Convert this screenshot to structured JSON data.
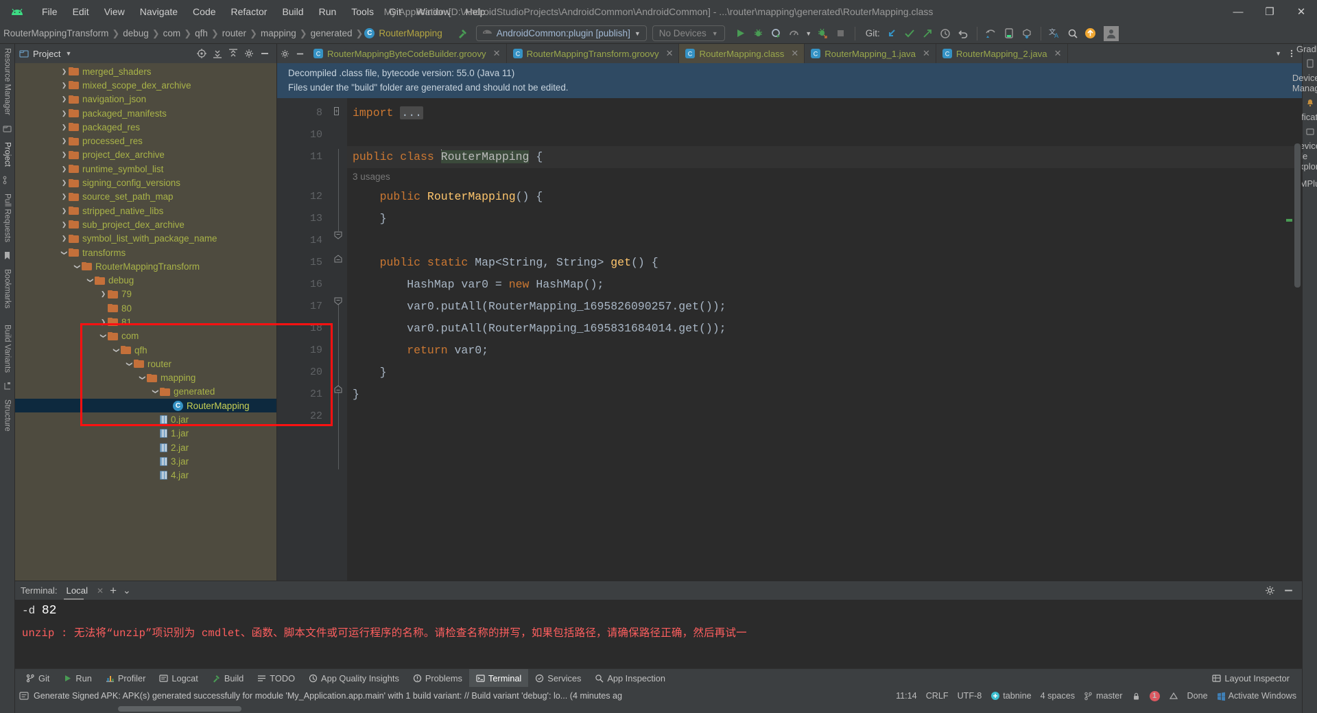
{
  "window": {
    "title": "My Application [D:\\AndroidStudioProjects\\AndroidCommon\\AndroidCommon] - ...\\router\\mapping\\generated\\RouterMapping.class",
    "minimize": "—",
    "maximize": "❐",
    "close": "✕"
  },
  "menu": [
    "File",
    "Edit",
    "View",
    "Navigate",
    "Code",
    "Refactor",
    "Build",
    "Run",
    "Tools",
    "Git",
    "Window",
    "Help"
  ],
  "breadcrumbs": [
    {
      "label": "RouterMappingTransform",
      "type": "text"
    },
    {
      "label": "debug",
      "type": "text"
    },
    {
      "label": "com",
      "type": "text"
    },
    {
      "label": "qfh",
      "type": "text"
    },
    {
      "label": "router",
      "type": "text"
    },
    {
      "label": "mapping",
      "type": "text"
    },
    {
      "label": "generated",
      "type": "text"
    },
    {
      "label": "RouterMapping",
      "type": "class"
    }
  ],
  "toolbar": {
    "run_config": "AndroidCommon:plugin [publish]",
    "device_selector": "No Devices",
    "git_label": "Git:",
    "icons": [
      "run-icon",
      "debug-icon",
      "run-coverage-icon",
      "profile-icon",
      "dropdown-icon",
      "attach-debugger-icon",
      "stop-icon",
      "git-update-icon",
      "git-commit-icon",
      "git-push-icon",
      "git-history-icon",
      "undo-icon",
      "sync-gradle-icon",
      "avd-manager-icon",
      "sdk-manager-icon",
      "translate-icon",
      "search-icon",
      "update-icon",
      "avatar-icon"
    ]
  },
  "project_panel": {
    "title": "Project",
    "header_icons": [
      "target-icon",
      "expand-all-icon",
      "collapse-all-icon",
      "settings-icon",
      "hide-icon"
    ],
    "tree": [
      {
        "label": "merged_shaders",
        "depth": 3,
        "type": "folder",
        "arrow": "right"
      },
      {
        "label": "mixed_scope_dex_archive",
        "depth": 3,
        "type": "folder",
        "arrow": "right"
      },
      {
        "label": "navigation_json",
        "depth": 3,
        "type": "folder",
        "arrow": "right"
      },
      {
        "label": "packaged_manifests",
        "depth": 3,
        "type": "folder",
        "arrow": "right"
      },
      {
        "label": "packaged_res",
        "depth": 3,
        "type": "folder",
        "arrow": "right"
      },
      {
        "label": "processed_res",
        "depth": 3,
        "type": "folder",
        "arrow": "right"
      },
      {
        "label": "project_dex_archive",
        "depth": 3,
        "type": "folder",
        "arrow": "right"
      },
      {
        "label": "runtime_symbol_list",
        "depth": 3,
        "type": "folder",
        "arrow": "right"
      },
      {
        "label": "signing_config_versions",
        "depth": 3,
        "type": "folder",
        "arrow": "right"
      },
      {
        "label": "source_set_path_map",
        "depth": 3,
        "type": "folder",
        "arrow": "right"
      },
      {
        "label": "stripped_native_libs",
        "depth": 3,
        "type": "folder",
        "arrow": "right"
      },
      {
        "label": "sub_project_dex_archive",
        "depth": 3,
        "type": "folder",
        "arrow": "right"
      },
      {
        "label": "symbol_list_with_package_name",
        "depth": 3,
        "type": "folder",
        "arrow": "right"
      },
      {
        "label": "transforms",
        "depth": 3,
        "type": "folder",
        "arrow": "down"
      },
      {
        "label": "RouterMappingTransform",
        "depth": 4,
        "type": "folder",
        "arrow": "down"
      },
      {
        "label": "debug",
        "depth": 5,
        "type": "folder",
        "arrow": "down"
      },
      {
        "label": "79",
        "depth": 6,
        "type": "folder",
        "arrow": "right"
      },
      {
        "label": "80",
        "depth": 6,
        "type": "folder",
        "arrow": "none"
      },
      {
        "label": "81",
        "depth": 6,
        "type": "folder",
        "arrow": "right"
      },
      {
        "label": "com",
        "depth": 6,
        "type": "folder",
        "arrow": "down"
      },
      {
        "label": "qfh",
        "depth": 7,
        "type": "folder",
        "arrow": "down"
      },
      {
        "label": "router",
        "depth": 8,
        "type": "folder",
        "arrow": "down"
      },
      {
        "label": "mapping",
        "depth": 9,
        "type": "folder",
        "arrow": "down"
      },
      {
        "label": "generated",
        "depth": 10,
        "type": "folder",
        "arrow": "down"
      },
      {
        "label": "RouterMapping",
        "depth": 11,
        "type": "class",
        "arrow": "none",
        "selected": true
      },
      {
        "label": "0.jar",
        "depth": 10,
        "type": "jar",
        "arrow": "none"
      },
      {
        "label": "1.jar",
        "depth": 10,
        "type": "jar",
        "arrow": "none"
      },
      {
        "label": "2.jar",
        "depth": 10,
        "type": "jar",
        "arrow": "none"
      },
      {
        "label": "3.jar",
        "depth": 10,
        "type": "jar",
        "arrow": "none"
      },
      {
        "label": "4.jar",
        "depth": 10,
        "type": "jar",
        "arrow": "none"
      }
    ]
  },
  "editor": {
    "tabs": [
      {
        "label": "RouterMappingByteCodeBuilder.groovy",
        "icon": "groovy-class-icon",
        "active": false
      },
      {
        "label": "RouterMappingTransform.groovy",
        "icon": "groovy-class-icon",
        "active": false
      },
      {
        "label": "RouterMapping.class",
        "icon": "java-class-icon",
        "active": true
      },
      {
        "label": "RouterMapping_1.java",
        "icon": "java-class-icon",
        "active": false
      },
      {
        "label": "RouterMapping_2.java",
        "icon": "java-class-icon",
        "active": false
      }
    ],
    "notice_line1": "Decompiled .class file, bytecode version: 55.0 (Java 11)",
    "notice_line2": "Files under the \"build\" folder are generated and should not be edited.",
    "usages_hint": "3 usages",
    "lines": [
      {
        "num": "8",
        "tokens": [
          {
            "t": "import ",
            "c": "kw"
          },
          {
            "t": "...",
            "c": "ell"
          }
        ]
      },
      {
        "num": "10",
        "tokens": []
      },
      {
        "num": "11",
        "tokens": [
          {
            "t": "public class ",
            "c": "kw"
          },
          {
            "t": "RouterMapping",
            "c": "hl"
          },
          {
            "t": " {",
            "c": "pl"
          }
        ]
      },
      {
        "num": "12",
        "tokens": [
          {
            "t": "    public ",
            "c": "kw"
          },
          {
            "t": "RouterMapping",
            "c": "fn"
          },
          {
            "t": "() {",
            "c": "pl"
          }
        ]
      },
      {
        "num": "13",
        "tokens": [
          {
            "t": "    }",
            "c": "pl"
          }
        ]
      },
      {
        "num": "14",
        "tokens": []
      },
      {
        "num": "15",
        "tokens": [
          {
            "t": "    public static ",
            "c": "kw"
          },
          {
            "t": "Map<String, String> ",
            "c": "cls"
          },
          {
            "t": "get",
            "c": "fn"
          },
          {
            "t": "() {",
            "c": "pl"
          }
        ]
      },
      {
        "num": "16",
        "tokens": [
          {
            "t": "        HashMap var0 = ",
            "c": "cls"
          },
          {
            "t": "new ",
            "c": "kw"
          },
          {
            "t": "HashMap();",
            "c": "cls"
          }
        ]
      },
      {
        "num": "17",
        "tokens": [
          {
            "t": "        var0.putAll(RouterMapping_1695826090257.get());",
            "c": "cls"
          }
        ]
      },
      {
        "num": "18",
        "tokens": [
          {
            "t": "        var0.putAll(RouterMapping_1695831684014.get());",
            "c": "cls"
          }
        ]
      },
      {
        "num": "19",
        "tokens": [
          {
            "t": "        return ",
            "c": "kw"
          },
          {
            "t": "var0;",
            "c": "cls"
          }
        ]
      },
      {
        "num": "20",
        "tokens": [
          {
            "t": "    }",
            "c": "pl"
          }
        ]
      },
      {
        "num": "21",
        "tokens": [
          {
            "t": "}",
            "c": "pl"
          }
        ]
      },
      {
        "num": "22",
        "tokens": []
      }
    ]
  },
  "terminal": {
    "label": "Terminal:",
    "tab": "Local",
    "add": "+",
    "dropdown": "⌄",
    "line1_prefix": "-d ",
    "line1_value": "82",
    "error": "unzip : 无法将“unzip”项识别为 cmdlet、函数、脚本文件或可运行程序的名称。请检查名称的拼写，如果包括路径，请确保路径正确，然后再试一"
  },
  "toolstrip": {
    "items": [
      {
        "label": "Git",
        "icon": "git-icon",
        "selected": false
      },
      {
        "label": "Run",
        "icon": "run-icon",
        "selected": false
      },
      {
        "label": "Profiler",
        "icon": "profiler-icon",
        "selected": false
      },
      {
        "label": "Logcat",
        "icon": "logcat-icon",
        "selected": false
      },
      {
        "label": "Build",
        "icon": "build-icon",
        "selected": false
      },
      {
        "label": "TODO",
        "icon": "todo-icon",
        "selected": false
      },
      {
        "label": "App Quality Insights",
        "icon": "insights-icon",
        "selected": false
      },
      {
        "label": "Problems",
        "icon": "problems-icon",
        "selected": false
      },
      {
        "label": "Terminal",
        "icon": "terminal-icon",
        "selected": true
      },
      {
        "label": "Services",
        "icon": "services-icon",
        "selected": false
      },
      {
        "label": "App Inspection",
        "icon": "app-inspection-icon",
        "selected": false
      }
    ],
    "layout_inspector": "Layout Inspector"
  },
  "statusbar": {
    "message": "Generate Signed APK: APK(s) generated successfully for module 'My_Application.app.main' with 1 build variant: // Build variant 'debug': lo... (4 minutes ag",
    "time": "11:14",
    "line_sep": "CRLF",
    "encoding": "UTF-8",
    "plugin": "tabnine",
    "indent": "4 spaces",
    "branch": "master",
    "errors": "1",
    "status": "Done",
    "watermark": "Activate Windows"
  },
  "left_rail": [
    "Resource Manager",
    "Project",
    "Pull Requests",
    "Bookmarks",
    "Build Variants",
    "Structure"
  ],
  "right_rail": [
    "Gradle",
    "Device Manager",
    "Notifications",
    "Device File Explorer",
    "ASMPlugin"
  ]
}
